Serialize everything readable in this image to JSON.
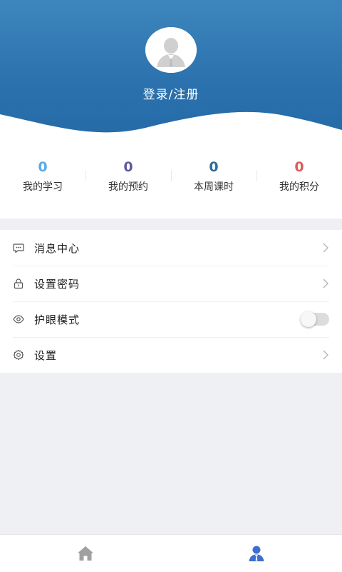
{
  "header": {
    "login_label": "登录/注册",
    "avatar_icon": "user-avatar-icon",
    "gradient_top": "#3d86bd",
    "gradient_bottom": "#236aa6"
  },
  "stats": [
    {
      "value": "0",
      "label": "我的学习",
      "color": "#5aa9e6"
    },
    {
      "value": "0",
      "label": "我的预约",
      "color": "#5d5a99"
    },
    {
      "value": "0",
      "label": "本周课时",
      "color": "#2d6b9c"
    },
    {
      "value": "0",
      "label": "我的积分",
      "color": "#e05a5a"
    }
  ],
  "menu": [
    {
      "label": "消息中心",
      "icon": "message-icon",
      "trailing": "chevron-right-icon"
    },
    {
      "label": "设置密码",
      "icon": "lock-icon",
      "trailing": "chevron-right-icon"
    },
    {
      "label": "护眼模式",
      "icon": "eye-icon",
      "trailing": "toggle",
      "toggle_on": false
    },
    {
      "label": "设置",
      "icon": "gear-icon",
      "trailing": "chevron-right-icon"
    }
  ],
  "tabbar": [
    {
      "icon": "home-icon",
      "active": false,
      "color": "#a0a0a0"
    },
    {
      "icon": "user-icon",
      "active": true,
      "color": "#3d6fd1"
    }
  ]
}
